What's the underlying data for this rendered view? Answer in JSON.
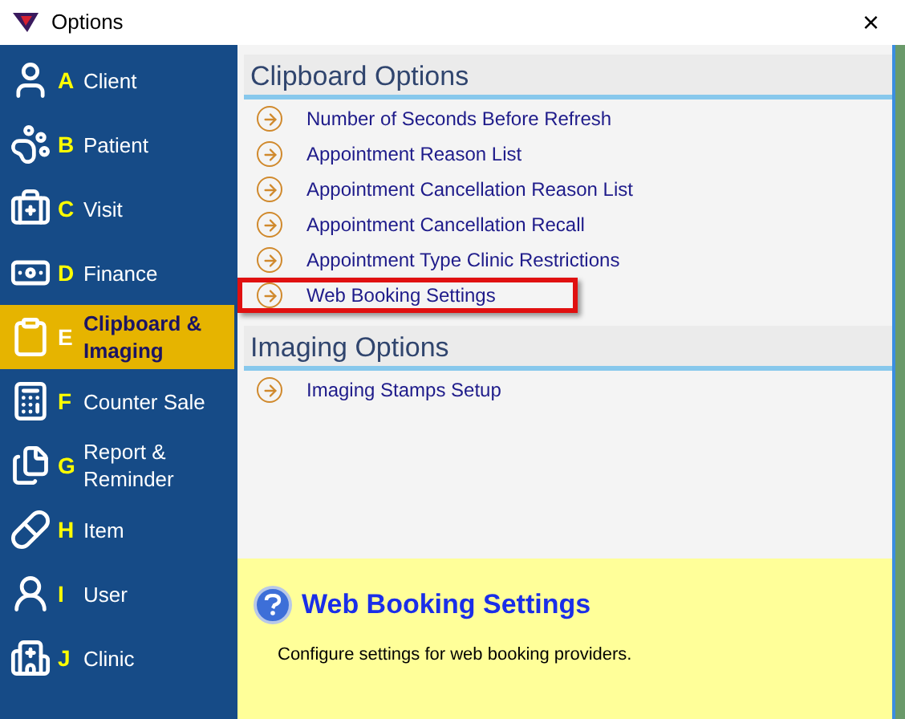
{
  "window": {
    "title": "Options",
    "close": "×"
  },
  "sidebar": {
    "items": [
      {
        "letter": "A",
        "label": "Client",
        "selected": false
      },
      {
        "letter": "B",
        "label": "Patient",
        "selected": false
      },
      {
        "letter": "C",
        "label": "Visit",
        "selected": false
      },
      {
        "letter": "D",
        "label": "Finance",
        "selected": false
      },
      {
        "letter": "E",
        "label": "Clipboard & Imaging",
        "selected": true
      },
      {
        "letter": "F",
        "label": "Counter Sale",
        "selected": false
      },
      {
        "letter": "G",
        "label": "Report & Reminder",
        "selected": false
      },
      {
        "letter": "H",
        "label": "Item",
        "selected": false
      },
      {
        "letter": "I",
        "label": "User",
        "selected": false
      },
      {
        "letter": "J",
        "label": "Clinic",
        "selected": false
      }
    ]
  },
  "sections": [
    {
      "title": "Clipboard Options",
      "items": [
        {
          "label": "Number of Seconds Before Refresh",
          "highlighted": false
        },
        {
          "label": "Appointment Reason List",
          "highlighted": false
        },
        {
          "label": "Appointment Cancellation Reason List",
          "highlighted": false
        },
        {
          "label": "Appointment Cancellation Recall",
          "highlighted": false
        },
        {
          "label": "Appointment Type Clinic Restrictions",
          "highlighted": false
        },
        {
          "label": "Web Booking Settings",
          "highlighted": true
        }
      ]
    },
    {
      "title": "Imaging Options",
      "items": [
        {
          "label": "Imaging Stamps Setup",
          "highlighted": false
        }
      ]
    }
  ],
  "help": {
    "title": "Web Booking Settings",
    "description": "Configure settings for web booking providers."
  }
}
